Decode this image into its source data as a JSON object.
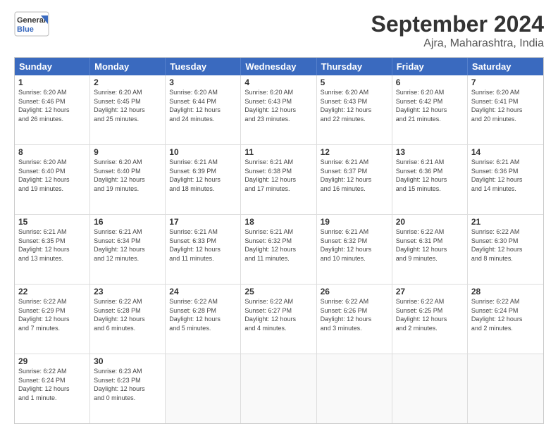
{
  "header": {
    "logo_line1": "General",
    "logo_line2": "Blue",
    "title": "September 2024",
    "subtitle": "Ajra, Maharashtra, India"
  },
  "days_of_week": [
    "Sunday",
    "Monday",
    "Tuesday",
    "Wednesday",
    "Thursday",
    "Friday",
    "Saturday"
  ],
  "weeks": [
    [
      {
        "day": "1",
        "lines": [
          "Sunrise: 6:20 AM",
          "Sunset: 6:46 PM",
          "Daylight: 12 hours",
          "and 26 minutes."
        ]
      },
      {
        "day": "2",
        "lines": [
          "Sunrise: 6:20 AM",
          "Sunset: 6:45 PM",
          "Daylight: 12 hours",
          "and 25 minutes."
        ]
      },
      {
        "day": "3",
        "lines": [
          "Sunrise: 6:20 AM",
          "Sunset: 6:44 PM",
          "Daylight: 12 hours",
          "and 24 minutes."
        ]
      },
      {
        "day": "4",
        "lines": [
          "Sunrise: 6:20 AM",
          "Sunset: 6:43 PM",
          "Daylight: 12 hours",
          "and 23 minutes."
        ]
      },
      {
        "day": "5",
        "lines": [
          "Sunrise: 6:20 AM",
          "Sunset: 6:43 PM",
          "Daylight: 12 hours",
          "and 22 minutes."
        ]
      },
      {
        "day": "6",
        "lines": [
          "Sunrise: 6:20 AM",
          "Sunset: 6:42 PM",
          "Daylight: 12 hours",
          "and 21 minutes."
        ]
      },
      {
        "day": "7",
        "lines": [
          "Sunrise: 6:20 AM",
          "Sunset: 6:41 PM",
          "Daylight: 12 hours",
          "and 20 minutes."
        ]
      }
    ],
    [
      {
        "day": "8",
        "lines": [
          "Sunrise: 6:20 AM",
          "Sunset: 6:40 PM",
          "Daylight: 12 hours",
          "and 19 minutes."
        ]
      },
      {
        "day": "9",
        "lines": [
          "Sunrise: 6:20 AM",
          "Sunset: 6:40 PM",
          "Daylight: 12 hours",
          "and 19 minutes."
        ]
      },
      {
        "day": "10",
        "lines": [
          "Sunrise: 6:21 AM",
          "Sunset: 6:39 PM",
          "Daylight: 12 hours",
          "and 18 minutes."
        ]
      },
      {
        "day": "11",
        "lines": [
          "Sunrise: 6:21 AM",
          "Sunset: 6:38 PM",
          "Daylight: 12 hours",
          "and 17 minutes."
        ]
      },
      {
        "day": "12",
        "lines": [
          "Sunrise: 6:21 AM",
          "Sunset: 6:37 PM",
          "Daylight: 12 hours",
          "and 16 minutes."
        ]
      },
      {
        "day": "13",
        "lines": [
          "Sunrise: 6:21 AM",
          "Sunset: 6:36 PM",
          "Daylight: 12 hours",
          "and 15 minutes."
        ]
      },
      {
        "day": "14",
        "lines": [
          "Sunrise: 6:21 AM",
          "Sunset: 6:36 PM",
          "Daylight: 12 hours",
          "and 14 minutes."
        ]
      }
    ],
    [
      {
        "day": "15",
        "lines": [
          "Sunrise: 6:21 AM",
          "Sunset: 6:35 PM",
          "Daylight: 12 hours",
          "and 13 minutes."
        ]
      },
      {
        "day": "16",
        "lines": [
          "Sunrise: 6:21 AM",
          "Sunset: 6:34 PM",
          "Daylight: 12 hours",
          "and 12 minutes."
        ]
      },
      {
        "day": "17",
        "lines": [
          "Sunrise: 6:21 AM",
          "Sunset: 6:33 PM",
          "Daylight: 12 hours",
          "and 11 minutes."
        ]
      },
      {
        "day": "18",
        "lines": [
          "Sunrise: 6:21 AM",
          "Sunset: 6:32 PM",
          "Daylight: 12 hours",
          "and 11 minutes."
        ]
      },
      {
        "day": "19",
        "lines": [
          "Sunrise: 6:21 AM",
          "Sunset: 6:32 PM",
          "Daylight: 12 hours",
          "and 10 minutes."
        ]
      },
      {
        "day": "20",
        "lines": [
          "Sunrise: 6:22 AM",
          "Sunset: 6:31 PM",
          "Daylight: 12 hours",
          "and 9 minutes."
        ]
      },
      {
        "day": "21",
        "lines": [
          "Sunrise: 6:22 AM",
          "Sunset: 6:30 PM",
          "Daylight: 12 hours",
          "and 8 minutes."
        ]
      }
    ],
    [
      {
        "day": "22",
        "lines": [
          "Sunrise: 6:22 AM",
          "Sunset: 6:29 PM",
          "Daylight: 12 hours",
          "and 7 minutes."
        ]
      },
      {
        "day": "23",
        "lines": [
          "Sunrise: 6:22 AM",
          "Sunset: 6:28 PM",
          "Daylight: 12 hours",
          "and 6 minutes."
        ]
      },
      {
        "day": "24",
        "lines": [
          "Sunrise: 6:22 AM",
          "Sunset: 6:28 PM",
          "Daylight: 12 hours",
          "and 5 minutes."
        ]
      },
      {
        "day": "25",
        "lines": [
          "Sunrise: 6:22 AM",
          "Sunset: 6:27 PM",
          "Daylight: 12 hours",
          "and 4 minutes."
        ]
      },
      {
        "day": "26",
        "lines": [
          "Sunrise: 6:22 AM",
          "Sunset: 6:26 PM",
          "Daylight: 12 hours",
          "and 3 minutes."
        ]
      },
      {
        "day": "27",
        "lines": [
          "Sunrise: 6:22 AM",
          "Sunset: 6:25 PM",
          "Daylight: 12 hours",
          "and 2 minutes."
        ]
      },
      {
        "day": "28",
        "lines": [
          "Sunrise: 6:22 AM",
          "Sunset: 6:24 PM",
          "Daylight: 12 hours",
          "and 2 minutes."
        ]
      }
    ],
    [
      {
        "day": "29",
        "lines": [
          "Sunrise: 6:22 AM",
          "Sunset: 6:24 PM",
          "Daylight: 12 hours",
          "and 1 minute."
        ]
      },
      {
        "day": "30",
        "lines": [
          "Sunrise: 6:23 AM",
          "Sunset: 6:23 PM",
          "Daylight: 12 hours",
          "and 0 minutes."
        ]
      },
      {
        "day": "",
        "lines": []
      },
      {
        "day": "",
        "lines": []
      },
      {
        "day": "",
        "lines": []
      },
      {
        "day": "",
        "lines": []
      },
      {
        "day": "",
        "lines": []
      }
    ]
  ]
}
